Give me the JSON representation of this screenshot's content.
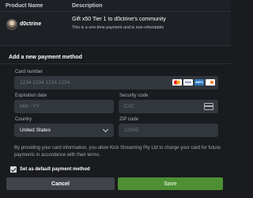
{
  "table": {
    "headers": {
      "product": "Product Name",
      "description": "Description"
    },
    "row": {
      "product_name": "d0ctrine",
      "title": "Gift x50 Tier 1 to d0ctrine's community",
      "note": "This is a one-time payment and is non-refundable"
    }
  },
  "payment": {
    "section_title": "Add a new payment method",
    "card_number": {
      "label": "Card number",
      "placeholder": "1234 1234 1234 1234",
      "brands": [
        "mastercard",
        "VISA",
        "AMEX",
        "discover"
      ]
    },
    "expiration": {
      "label": "Expiration date",
      "placeholder": "MM / YY"
    },
    "security": {
      "label": "Security code",
      "placeholder": "CVC"
    },
    "country": {
      "label": "Country",
      "value": "United States"
    },
    "zip": {
      "label": "ZIP code",
      "placeholder": "12345"
    },
    "disclaimer": "By providing your card information, you allow Kick Streaming Pty Ltd to charge your card for future payments in accordance with their terms.",
    "default_label": "Set as default payment method",
    "default_checked": true
  },
  "buttons": {
    "cancel": "Cancel",
    "save": "Save"
  },
  "colors": {
    "background": "#191b1f",
    "field": "#32363d",
    "save": "#4e8f33",
    "cancel": "#3f434a"
  }
}
